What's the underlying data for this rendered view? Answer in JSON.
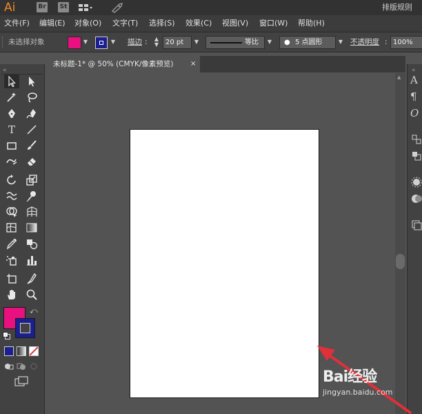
{
  "app": {
    "logo": "Ai",
    "badges": [
      "Br",
      "St"
    ],
    "workspace": "排版规则"
  },
  "menu": [
    "文件(F)",
    "编辑(E)",
    "对象(O)",
    "文字(T)",
    "选择(S)",
    "效果(C)",
    "视图(V)",
    "窗口(W)",
    "帮助(H)"
  ],
  "control": {
    "selection_status": "未选择对象",
    "fill_color": "#e8117f",
    "stroke_color": "#1b1f8f",
    "stroke_label": "描边",
    "stroke_value": "20 pt",
    "profile_label": "等比",
    "brush_label": "5 点圆形",
    "opacity_label": "不透明度",
    "opacity_value": "100%"
  },
  "document": {
    "tab_title": "未标题-1* @ 50% (CMYK/像素预览)",
    "close_glyph": "×"
  },
  "tools": [
    "selection-tool",
    "direct-selection-tool",
    "magic-wand-tool",
    "lasso-tool",
    "pen-tool",
    "curvature-tool",
    "type-tool",
    "line-tool",
    "rectangle-tool",
    "paintbrush-tool",
    "shaper-tool",
    "eraser-tool",
    "rotate-tool",
    "scale-tool",
    "warp-tool",
    "puppet-warp-tool",
    "shape-builder-tool",
    "perspective-grid-tool",
    "mesh-tool",
    "gradient-tool",
    "eyedropper-tool",
    "blend-tool",
    "symbol-sprayer-tool",
    "column-graph-tool",
    "artboard-tool",
    "slice-tool",
    "hand-tool",
    "zoom-tool"
  ],
  "toolbar_colors": {
    "fill": "#e8117f",
    "stroke": "#1b1f8f"
  },
  "watermark": {
    "logo": "Bai经验",
    "url": "jingyan.baidu.com"
  },
  "colors": {
    "background": "#535353",
    "panel": "#424242",
    "artboard": "#ffffff",
    "accent": "#f08a24",
    "arrow": "#e0303a"
  }
}
